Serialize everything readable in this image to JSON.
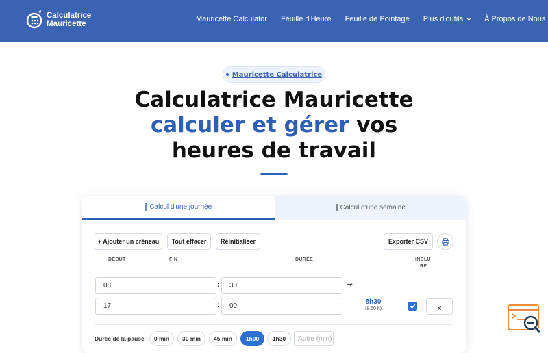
{
  "brand": {
    "line1": "Calculatrice",
    "line2": "Mauricette"
  },
  "nav": {
    "items": [
      {
        "label": "Mauricette Calculator",
        "dropdown": false
      },
      {
        "label": "Feuille d'Heure",
        "dropdown": false
      },
      {
        "label": "Feuille de Pointage",
        "dropdown": false
      },
      {
        "label": "Plus d'outils",
        "dropdown": true
      },
      {
        "label": "À Propos de Nous",
        "dropdown": true
      }
    ]
  },
  "hero": {
    "badge": "Mauricette Calculatrice",
    "title_line1": "Calculatrice Mauricette",
    "title_accent": "calculer et gérer",
    "title_line2_rest": " vos",
    "title_line3": "heures de travail"
  },
  "calculator": {
    "tabs": [
      {
        "label": "Calcul d'une journée",
        "active": true
      },
      {
        "label": "Calcul d'une semaine",
        "active": false
      }
    ],
    "actions": {
      "add": "+ Ajouter un créneau",
      "clear": "Tout effacer",
      "reset": "Réinitialiser",
      "export": "Exporter CSV"
    },
    "columns": {
      "start": "DÉBUT",
      "end": "FIN",
      "duration": "DURÉE",
      "include_1": "INCLU",
      "include_2": "RE"
    },
    "rows": [
      {
        "start_h": "08",
        "end_h": "30"
      },
      {
        "start_h": "17",
        "end_h": "00"
      }
    ],
    "duration": {
      "value": "8h30",
      "decimal": "(8.50 h)"
    },
    "include_checked": true,
    "delete_label": "×",
    "pause": {
      "label": "Durée de la pause :",
      "options": [
        "0 min",
        "30 min",
        "45 min",
        "1h00",
        "1h30"
      ],
      "selected": "1h00",
      "custom_placeholder": "Autre (min)"
    }
  },
  "colors": {
    "header": "#3a63b3",
    "accent": "#2e5fb7",
    "checkbox": "#2e6fd0"
  }
}
